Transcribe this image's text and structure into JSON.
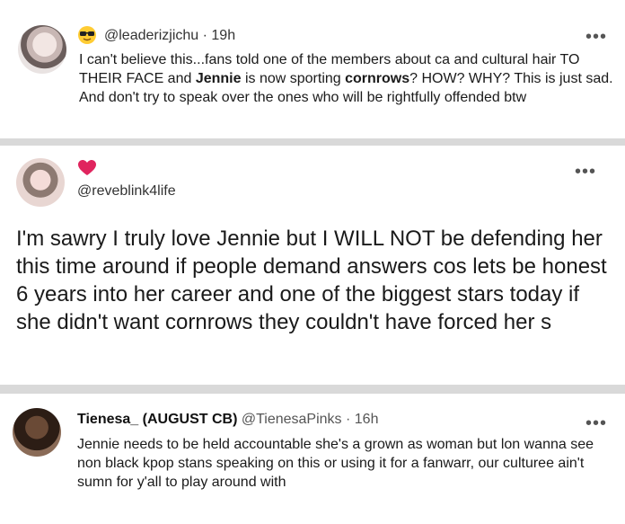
{
  "tweets": [
    {
      "handle": "@leaderizjichu · 19h",
      "emoji": "sunglasses-emoji",
      "text_parts": [
        "I can't believe this...fans told one of the members about ca and cultural hair TO THEIR FACE and ",
        "Jennie",
        " is now sporting ",
        "cornrows",
        "? HOW? WHY? This is just sad. And don't try to speak over the ones who will be rightfully offended btw"
      ],
      "more": "•••"
    },
    {
      "handle": "@reveblink4life",
      "emoji": "red-heart-emoji",
      "text": "I'm sawry I truly love Jennie but I WILL NOT be defending her this time around if people demand answers cos lets be honest 6 years into her career and one of the biggest stars today if she didn't want cornrows they couldn't have forced her s",
      "more": "•••"
    },
    {
      "name": "Tienesa_ (AUGUST CB)",
      "handle": "@TienesaPinks · 16h",
      "text": "Jennie needs to be held accountable she's a grown as woman but lon wanna see non black kpop stans speaking on this or using it for a fanwarr, our culturee ain't sumn for y'all to play around with",
      "more": "•••"
    }
  ],
  "colors": {
    "background": "#d9d9d9",
    "card": "#ffffff",
    "heart": "#e0245e"
  }
}
